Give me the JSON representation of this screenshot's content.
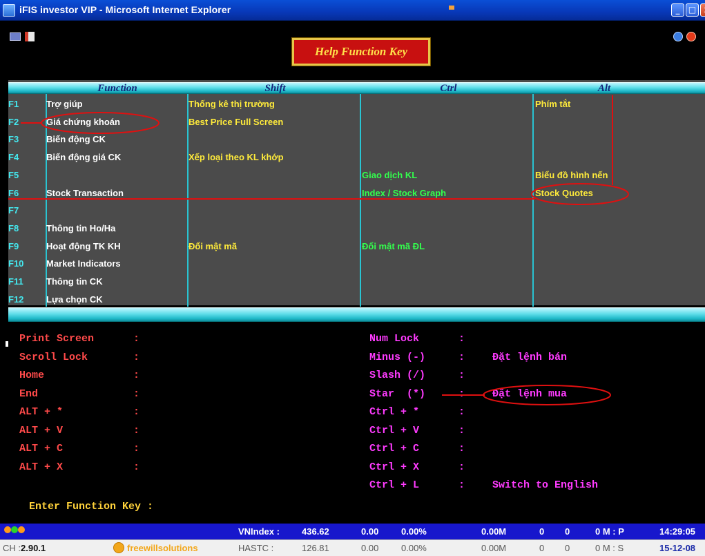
{
  "window": {
    "title": "iFIS investor VIP - Microsoft Internet Explorer",
    "buttons": {
      "minimize": "_",
      "maximize": "□",
      "close": "x"
    }
  },
  "toolbar": {
    "help_label": "Help Function Key"
  },
  "fk_table": {
    "headers": {
      "function": "Function",
      "shift": "Shift",
      "ctrl": "Ctrl",
      "alt": "Alt"
    },
    "rows": [
      {
        "key": "F1",
        "function": "Trợ giúp",
        "shift": "Thống kê thị trường",
        "ctrl": "",
        "alt": "Phím tắt"
      },
      {
        "key": "F2",
        "function": "Giá chứng khoán",
        "shift": "Best Price Full Screen",
        "ctrl": "",
        "alt": ""
      },
      {
        "key": "F3",
        "function": "Biến động CK",
        "shift": "",
        "ctrl": "",
        "alt": ""
      },
      {
        "key": "F4",
        "function": "Biến động giá CK",
        "shift": "Xếp loại theo KL khớp",
        "ctrl": "",
        "alt": ""
      },
      {
        "key": "F5",
        "function": "",
        "shift": "",
        "ctrl": "Giao dịch KL",
        "alt": "Biểu đồ hình nến"
      },
      {
        "key": "F6",
        "function": "Stock Transaction",
        "shift": "",
        "ctrl": "Index / Stock Graph",
        "alt": "Stock Quotes"
      },
      {
        "key": "F7",
        "function": "",
        "shift": "",
        "ctrl": "",
        "alt": ""
      },
      {
        "key": "F8",
        "function": "Thông tin Ho/Ha",
        "shift": "",
        "ctrl": "",
        "alt": ""
      },
      {
        "key": "F9",
        "function": "Hoạt động TK KH",
        "shift": "Đổi mật mã",
        "ctrl": "Đổi mật mã ĐL",
        "alt": ""
      },
      {
        "key": "F10",
        "function": "Market Indicators",
        "shift": "",
        "ctrl": "",
        "alt": ""
      },
      {
        "key": "F11",
        "function": "Thông tin CK",
        "shift": "",
        "ctrl": "",
        "alt": ""
      },
      {
        "key": "F12",
        "function": "Lựa chọn CK",
        "shift": "",
        "ctrl": "",
        "alt": ""
      }
    ]
  },
  "keys_panel": {
    "colon": ":",
    "left_items": [
      "Print Screen",
      "Scroll Lock",
      "Home",
      "End",
      "ALT + *",
      "ALT + V",
      "ALT + C",
      "ALT + X"
    ],
    "right_items": [
      {
        "key": "Num Lock",
        "value": ""
      },
      {
        "key": "Minus (-)",
        "value": "Đặt lệnh bán"
      },
      {
        "key": "Slash (/)",
        "value": ""
      },
      {
        "key": "Star  (*)",
        "value": "Đặt lệnh mua"
      },
      {
        "key": "Ctrl + *",
        "value": ""
      },
      {
        "key": "Ctrl + V",
        "value": ""
      },
      {
        "key": "Ctrl + C",
        "value": ""
      },
      {
        "key": "Ctrl + X",
        "value": ""
      },
      {
        "key": "Ctrl + L",
        "value": "Switch to English"
      }
    ],
    "enter_prompt": "Enter Function Key :"
  },
  "status": {
    "row1": {
      "index_label": "VNIndex :",
      "index_value": "436.62",
      "change": "0.00",
      "percent": "0.00%",
      "volume": "0.00M",
      "n1": "0",
      "n2": "0",
      "mode": "0 M : P",
      "time": "14:29:05"
    },
    "row2": {
      "version_label": "CH :",
      "version": "2.90.1",
      "logo_text": "freewillsolutions",
      "index_label": "HASTC :",
      "index_value": "126.81",
      "change": "0.00",
      "percent": "0.00%",
      "volume": "0.00M",
      "n1": "0",
      "n2": "0",
      "mode": "0 M : S",
      "date": "15-12-08"
    },
    "dot_colors": [
      "#ff9a1a",
      "#2bd42b",
      "#ff9a1a"
    ]
  },
  "colors": {
    "header_text": "#13237a",
    "function_text": "#ffffff",
    "shift_text": "#ffeb3b",
    "ctrl_text": "#33ff4d",
    "alt_text": "#ffeb3b",
    "fkey_text": "#44e8ef",
    "annotation": "#e01010"
  }
}
